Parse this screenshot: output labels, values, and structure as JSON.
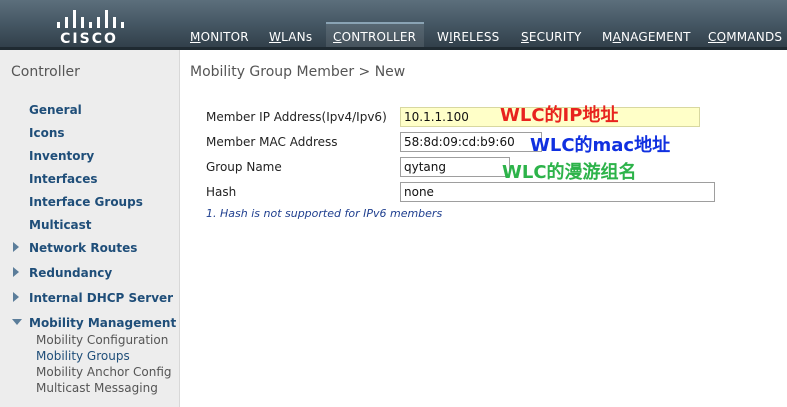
{
  "brand": {
    "logo_text": "CISCO"
  },
  "nav": {
    "items": [
      {
        "first": "M",
        "rest": "ONITOR"
      },
      {
        "first": "W",
        "rest": "LANs"
      },
      {
        "first": "C",
        "rest": "ONTROLLER"
      },
      {
        "first": "",
        "pre": "W",
        "mid": "I",
        "rest": "RELESS"
      },
      {
        "first": "S",
        "rest": "ECURITY"
      },
      {
        "first": "",
        "pre": "M",
        "mid": "A",
        "rest": "NAGEMENT"
      },
      {
        "first": "C",
        "rest": "O",
        "rest2": "MMANDS"
      }
    ],
    "active": "CONTROLLER"
  },
  "sidebar": {
    "title": "Controller",
    "items": [
      {
        "label": "General"
      },
      {
        "label": "Icons"
      },
      {
        "label": "Inventory"
      },
      {
        "label": "Interfaces"
      },
      {
        "label": "Interface Groups"
      },
      {
        "label": "Multicast"
      },
      {
        "label": "Network Routes"
      },
      {
        "label": "Redundancy"
      },
      {
        "label": "Internal DHCP Server"
      },
      {
        "label": "Mobility Management"
      }
    ],
    "sub_items": [
      {
        "label": "Mobility Configuration"
      },
      {
        "label": "Mobility Groups"
      },
      {
        "label": "Mobility Anchor Config"
      },
      {
        "label": "Multicast Messaging"
      }
    ]
  },
  "main": {
    "title": "Mobility Group Member > New",
    "fields": [
      {
        "label": "Member IP Address(Ipv4/Ipv6)",
        "value": "10.1.1.100"
      },
      {
        "label": "Member MAC Address",
        "value": "58:8d:09:cd:b9:60"
      },
      {
        "label": "Group Name",
        "value": "qytang"
      },
      {
        "label": "Hash",
        "value": "none"
      }
    ],
    "footnote": "1. Hash is not supported for IPv6 members"
  },
  "annotations": [
    {
      "text": "WLC的IP地址",
      "color": "#e8231e"
    },
    {
      "text": "WLC的mac地址",
      "color": "#1030e0"
    },
    {
      "text": "WLC的漫游组名",
      "color": "#2db34a"
    }
  ]
}
